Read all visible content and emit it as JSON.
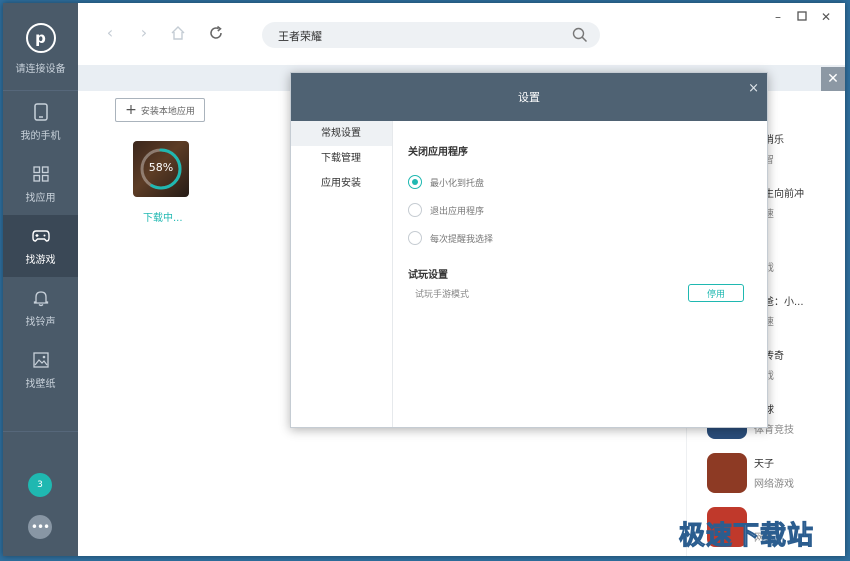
{
  "sidebar": {
    "connect_label": "请连接设备",
    "logo_letter": "p",
    "items": [
      {
        "label": "我的手机",
        "icon": "phone-icon"
      },
      {
        "label": "找应用",
        "icon": "apps-grid-icon"
      },
      {
        "label": "找游戏",
        "icon": "gamepad-icon",
        "active": true
      },
      {
        "label": "找铃声",
        "icon": "bell-icon"
      },
      {
        "label": "找壁纸",
        "icon": "image-icon"
      }
    ],
    "badge_count": "3",
    "more_label": "•••"
  },
  "toolbar": {
    "search_value": "王者荣耀"
  },
  "main": {
    "install_local_label": "安装本地应用",
    "download": {
      "percent": "58%",
      "progress": 0.58,
      "status": "下载中..."
    }
  },
  "right_list": [
    {
      "name": "消消乐",
      "category": "益智",
      "color": "#e55c8a"
    },
    {
      "name": "女生向前冲",
      "category": "竞速",
      "color": "#f0a12f"
    },
    {
      "name": "",
      "category": "游戏",
      "color": "#6a9b3c"
    },
    {
      "name": "奶爸：小...",
      "category": "竞速",
      "color": "#d9543c"
    },
    {
      "name": "冰传奇",
      "category": "游戏",
      "color": "#3d6fb6"
    },
    {
      "name": "台球",
      "category": "体育竞技",
      "color": "#2a4d7a"
    },
    {
      "name": "天子",
      "category": "网络游戏",
      "color": "#8d3a24"
    },
    {
      "name": "",
      "category": "网络",
      "color": "#c0392b"
    }
  ],
  "modal": {
    "title": "设置",
    "close": "×",
    "tabs": [
      "常规设置",
      "下载管理",
      "应用安装"
    ],
    "close_app_title": "关闭应用程序",
    "options": [
      "最小化到托盘",
      "退出应用程序",
      "每次提醒我选择"
    ],
    "selected_option": 0,
    "trial_title": "试玩设置",
    "trial_mode": "试玩手游模式",
    "stop_label": "停用"
  },
  "watermark": "极速下载站",
  "colors": {
    "accent": "#1fb8b1",
    "sidebar_bg": "#4a5a69",
    "modal_header": "#4f6273"
  }
}
